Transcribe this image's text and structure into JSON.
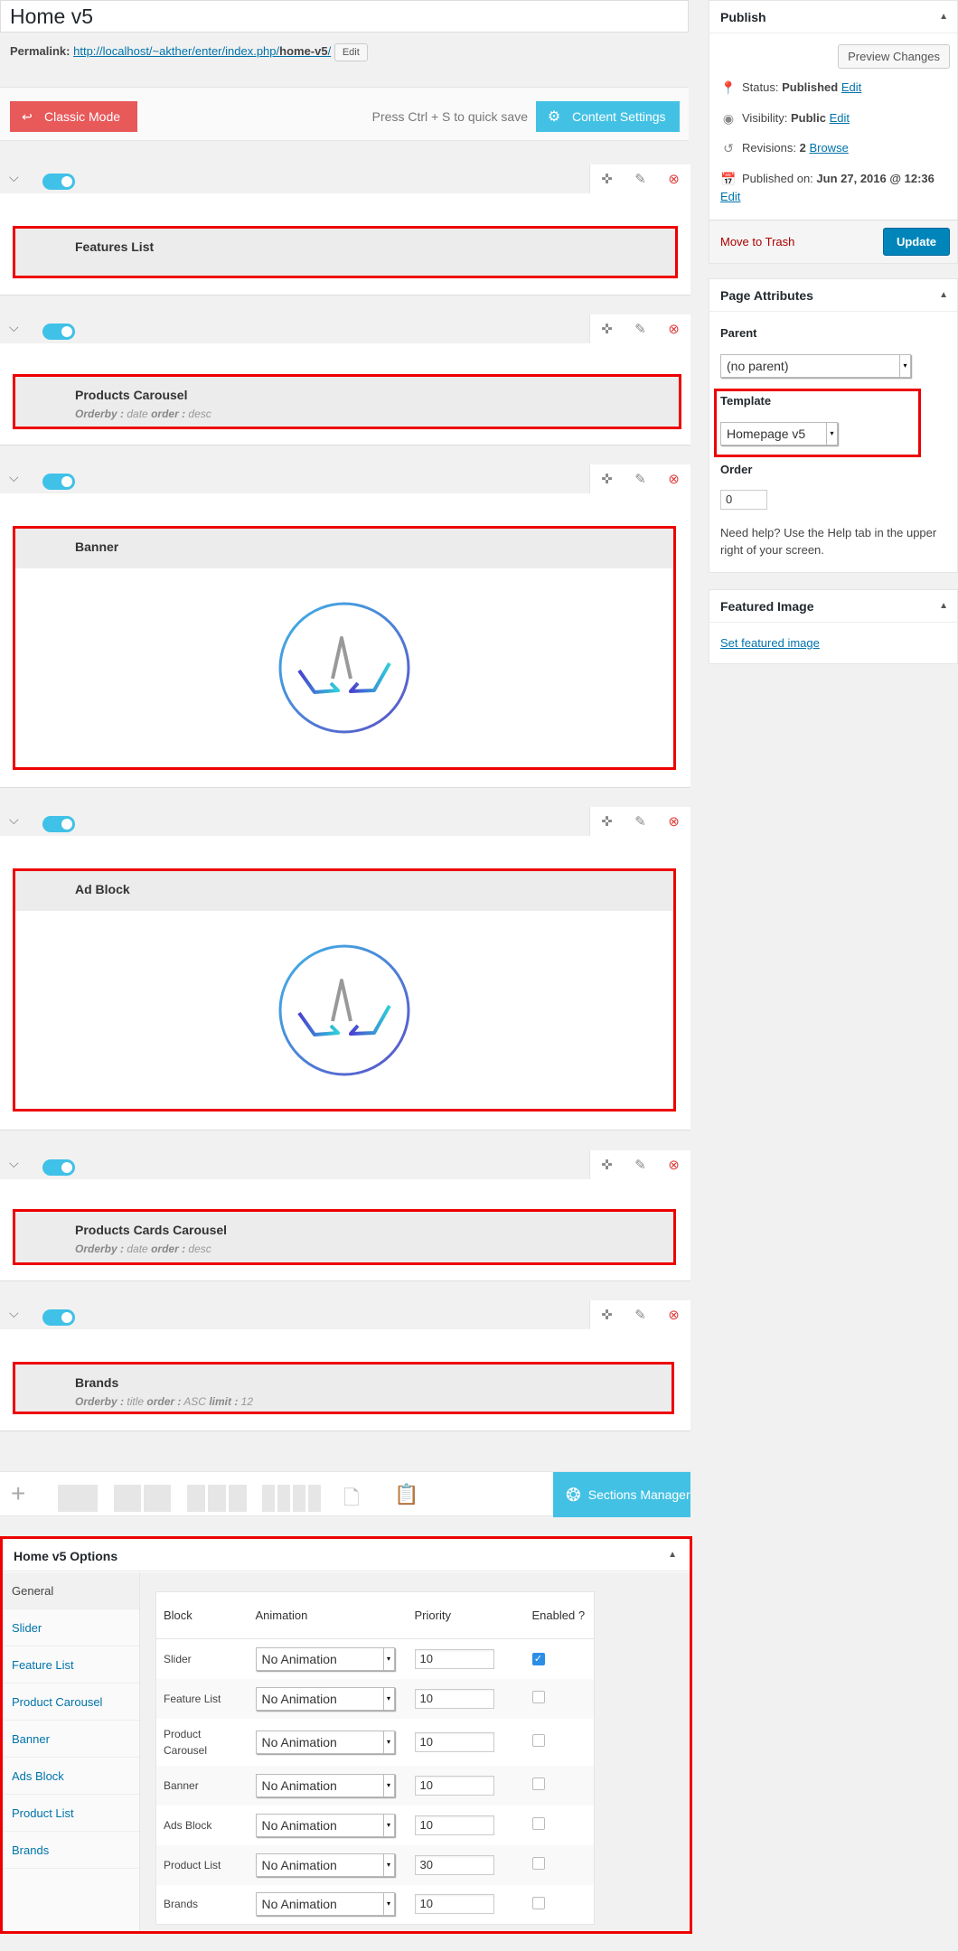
{
  "title": "Home v5",
  "permalink": {
    "label": "Permalink:",
    "url_base": "http://localhost/~akther/enter/index.php/",
    "slug": "home-v5",
    "url_end": "/",
    "edit_label": "Edit"
  },
  "mode_bar": {
    "classic_label": "Classic Mode",
    "quick_save": "Press Ctrl + S to quick save",
    "content_settings": "Content Settings"
  },
  "sections": [
    {
      "title": "Features List",
      "enabled": true
    },
    {
      "title": "Products Carousel",
      "enabled": true,
      "sub": {
        "orderby_label": "Orderby :",
        "orderby": "date",
        "order_label": "order :",
        "order": "desc"
      }
    },
    {
      "title": "Banner",
      "enabled": true
    },
    {
      "title": "Ad Block",
      "enabled": true
    },
    {
      "title": "Products Cards Carousel",
      "enabled": true,
      "sub": {
        "orderby_label": "Orderby :",
        "orderby": "date",
        "order_label": "order :",
        "order": "desc"
      }
    },
    {
      "title": "Brands",
      "enabled": true,
      "sub": {
        "orderby_label": "Orderby :",
        "orderby": "title",
        "order_label": "order :",
        "order": "ASC",
        "limit_label": "limit :",
        "limit": "12"
      }
    }
  ],
  "builder_bar": {
    "sections_manager": "Sections Manager"
  },
  "options": {
    "title": "Home v5 Options",
    "sidebar": [
      "General",
      "Slider",
      "Feature List",
      "Product Carousel",
      "Banner",
      "Ads Block",
      "Product List",
      "Brands"
    ],
    "columns": {
      "block": "Block",
      "animation": "Animation",
      "priority": "Priority",
      "enabled": "Enabled ?"
    },
    "rows": [
      {
        "block": "Slider",
        "animation": "No Animation",
        "priority": "10",
        "enabled": true
      },
      {
        "block": "Feature List",
        "animation": "No Animation",
        "priority": "10",
        "enabled": false
      },
      {
        "block": "Product Carousel",
        "animation": "No Animation",
        "priority": "10",
        "enabled": false
      },
      {
        "block": "Banner",
        "animation": "No Animation",
        "priority": "10",
        "enabled": false
      },
      {
        "block": "Ads Block",
        "animation": "No Animation",
        "priority": "10",
        "enabled": false
      },
      {
        "block": "Product List",
        "animation": "No Animation",
        "priority": "30",
        "enabled": false
      },
      {
        "block": "Brands",
        "animation": "No Animation",
        "priority": "10",
        "enabled": false
      }
    ]
  },
  "publish": {
    "title": "Publish",
    "preview": "Preview Changes",
    "status_label": "Status:",
    "status": "Published",
    "status_edit": "Edit",
    "visibility_label": "Visibility:",
    "visibility": "Public",
    "visibility_edit": "Edit",
    "revisions_label": "Revisions:",
    "revisions": "2",
    "revisions_browse": "Browse",
    "published_label": "Published on:",
    "published": "Jun 27, 2016 @ 12:36",
    "published_edit": "Edit",
    "trash": "Move to Trash",
    "update": "Update"
  },
  "page_attributes": {
    "title": "Page Attributes",
    "parent_label": "Parent",
    "parent_value": "(no parent)",
    "template_label": "Template",
    "template_value": "Homepage v5",
    "order_label": "Order",
    "order_value": "0",
    "help": "Need help? Use the Help tab in the upper right of your screen."
  },
  "featured_image": {
    "title": "Featured Image",
    "link": "Set featured image"
  },
  "colors": {
    "accent_blue": "#43c1e5",
    "classic_red": "#e8595a",
    "highlight_red": "#ee0000",
    "update_blue": "#0085ba"
  }
}
